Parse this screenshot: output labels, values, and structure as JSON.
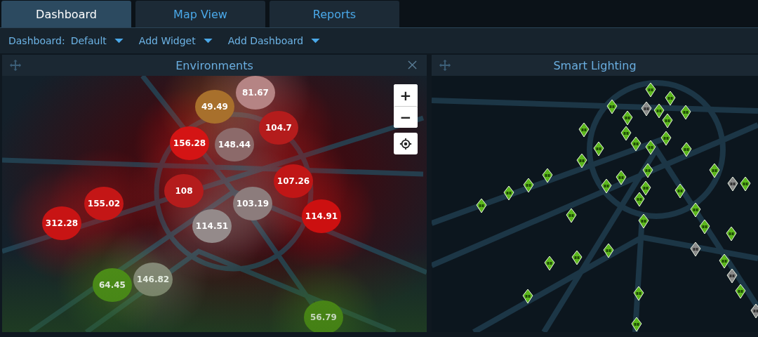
{
  "tabs": [
    {
      "label": "Dashboard",
      "selected": true
    },
    {
      "label": "Map View",
      "selected": false
    },
    {
      "label": "Reports",
      "selected": false
    }
  ],
  "toolbar": {
    "dashboard_label": "Dashboard:",
    "dashboard_value": "Default",
    "menus": [
      "Add Widget",
      "Add Dashboard"
    ]
  },
  "environments": {
    "title": "Environments",
    "zoom_in": "+",
    "zoom_out": "−",
    "markers": [
      {
        "value": "81.67",
        "color": "#b58484"
      },
      {
        "value": "49.49",
        "color": "#a8702c"
      },
      {
        "value": "104.7",
        "color": "#b41c1c"
      },
      {
        "value": "156.28",
        "color": "#d41414"
      },
      {
        "value": "148.44",
        "color": "#8c6a6a"
      },
      {
        "value": "107.26",
        "color": "#c01616"
      },
      {
        "value": "114.91",
        "color": "#cc1010"
      },
      {
        "value": "108",
        "color": "#b41c1c"
      },
      {
        "value": "103.19",
        "color": "#8c7c7c"
      },
      {
        "value": "114.51",
        "color": "#948a8a"
      },
      {
        "value": "155.02",
        "color": "#c41616"
      },
      {
        "value": "312.28",
        "color": "#c81414"
      },
      {
        "value": "146.82",
        "color": "#8a8a7e"
      },
      {
        "value": "64.45",
        "color": "#4e8e18"
      },
      {
        "value": "56.79",
        "color": "#4e8a16"
      }
    ]
  },
  "smart_lighting": {
    "title": "Smart Lighting",
    "lamps": [
      {
        "on": true
      },
      {
        "on": true
      },
      {
        "on": false
      },
      {
        "on": true
      },
      {
        "on": true
      },
      {
        "on": true
      },
      {
        "on": true
      },
      {
        "on": true
      },
      {
        "on": true
      },
      {
        "on": true
      },
      {
        "on": true
      },
      {
        "on": true
      },
      {
        "on": true
      },
      {
        "on": true
      },
      {
        "on": true
      },
      {
        "on": true
      },
      {
        "on": true
      },
      {
        "on": true
      },
      {
        "on": false
      },
      {
        "on": true
      },
      {
        "on": true
      },
      {
        "on": true
      },
      {
        "on": true
      },
      {
        "on": true
      },
      {
        "on": true
      },
      {
        "on": true
      },
      {
        "on": true
      },
      {
        "on": true
      },
      {
        "on": true
      },
      {
        "on": true
      },
      {
        "on": true
      },
      {
        "on": true
      },
      {
        "on": true
      },
      {
        "on": false
      },
      {
        "on": true
      },
      {
        "on": false
      },
      {
        "on": true
      },
      {
        "on": false
      },
      {
        "on": true
      },
      {
        "on": true
      },
      {
        "on": true
      },
      {
        "on": true
      },
      {
        "on": true
      },
      {
        "on": true
      },
      {
        "on": true
      }
    ]
  }
}
